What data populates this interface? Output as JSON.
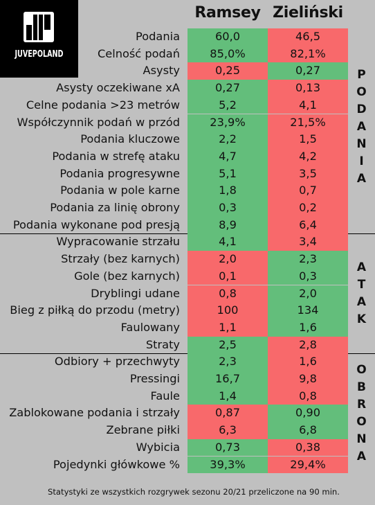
{
  "logo": {
    "icon": "juvepoland-bars-icon",
    "text": "JUVEPOLAND"
  },
  "players": [
    "Ramsey",
    "Zieliński"
  ],
  "colors": {
    "better": "#63be7b",
    "worse": "#f8696b",
    "background": "#c0c0c0"
  },
  "sections": [
    {
      "name": "PODANIA",
      "letters": [
        "P",
        "O",
        "D",
        "A",
        "N",
        "I",
        "A"
      ],
      "rows": [
        {
          "label": "Podania",
          "v1": "60,0",
          "v2": "46,5",
          "better": 1
        },
        {
          "label": "Celność podań",
          "v1": "85,0%",
          "v2": "82,1%",
          "better": 1
        },
        {
          "label": "Asysty",
          "v1": "0,25",
          "v2": "0,27",
          "better": 2
        },
        {
          "label": "Asysty oczekiwane xA ",
          "v1": "0,27",
          "v2": "0,13",
          "better": 1
        },
        {
          "label": "Celne podania >23 metrów",
          "v1": "5,2",
          "v2": "4,1",
          "better": 1
        },
        {
          "label": "Współczynnik podań w przód",
          "v1": "23,9%",
          "v2": "21,5%",
          "better": 1
        },
        {
          "label": "Podania kluczowe",
          "v1": "2,2",
          "v2": "1,5",
          "better": 1
        },
        {
          "label": "Podania w strefę ataku",
          "v1": "4,7",
          "v2": "4,2",
          "better": 1
        },
        {
          "label": "Podania progresywne",
          "v1": "5,1",
          "v2": "3,5",
          "better": 1
        },
        {
          "label": "Podania w pole karne",
          "v1": "1,8",
          "v2": "0,7",
          "better": 1
        },
        {
          "label": "Podania za linię obrony",
          "v1": "0,3",
          "v2": "0,2",
          "better": 1
        },
        {
          "label": "Podania wykonane pod presją",
          "v1": "8,9",
          "v2": "6,4",
          "better": 1
        }
      ]
    },
    {
      "name": "ATAK",
      "letters": [
        "A",
        "T",
        "A",
        "K"
      ],
      "rows": [
        {
          "label": "Wypracowanie strzału",
          "v1": "4,1",
          "v2": "3,4",
          "better": 1
        },
        {
          "label": "Strzały (bez karnych)",
          "v1": "2,0",
          "v2": "2,3",
          "better": 2
        },
        {
          "label": "Gole (bez karnych)",
          "v1": "0,1",
          "v2": "0,3",
          "better": 2
        },
        {
          "label": "Dryblingi udane",
          "v1": "0,8",
          "v2": "2,0",
          "better": 2
        },
        {
          "label": "Bieg z piłką do przodu (metry)",
          "v1": "100",
          "v2": "134",
          "better": 2
        },
        {
          "label": "Faulowany",
          "v1": "1,1",
          "v2": "1,6",
          "better": 2
        },
        {
          "label": "Straty",
          "v1": "2,5",
          "v2": "2,8",
          "better": 1
        }
      ]
    },
    {
      "name": "OBRONA",
      "letters": [
        "O",
        "B",
        "R",
        "O",
        "N",
        "A"
      ],
      "rows": [
        {
          "label": "Odbiory + przechwyty",
          "v1": "2,3",
          "v2": "1,6",
          "better": 1
        },
        {
          "label": "Pressingi",
          "v1": "16,7",
          "v2": "9,8",
          "better": 1
        },
        {
          "label": "Faule",
          "v1": "1,4",
          "v2": "0,8",
          "better": 1
        },
        {
          "label": "Zablokowane podania i strzały",
          "v1": "0,87",
          "v2": "0,90",
          "better": 2
        },
        {
          "label": "Zebrane piłki",
          "v1": "6,3",
          "v2": "6,8",
          "better": 2
        },
        {
          "label": "Wybicia",
          "v1": "0,73",
          "v2": "0,38",
          "better": 1
        },
        {
          "label": "Pojedynki główkowe %",
          "v1": "39,3%",
          "v2": "29,4%",
          "better": 1
        }
      ]
    }
  ],
  "footnote": "Statystyki ze wszystkich rozgrywek sezonu 20/21 przeliczone na 90 min."
}
